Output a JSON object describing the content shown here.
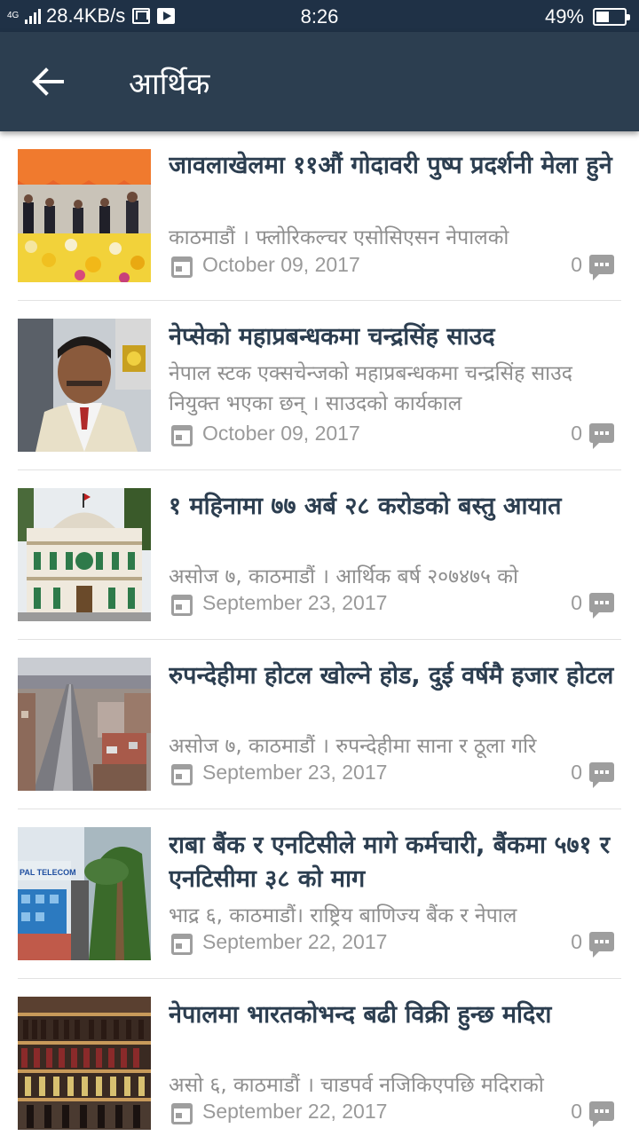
{
  "status_bar": {
    "network": "4G",
    "speed": "28.4KB/s",
    "time": "8:26",
    "battery": "49%"
  },
  "app_bar": {
    "back_icon": "arrow-left-icon",
    "title": "आर्थिक"
  },
  "colors": {
    "status_bar": "#1f3146",
    "app_bar": "#2c3e50",
    "headline": "#2c3e50",
    "meta_text": "#9a9a9a"
  },
  "articles": [
    {
      "headline": "जावलाखेलमा ११औं गोदावरी पुष्प प्रदर्शनी मेला हुने",
      "excerpt": "काठमाडौं । फ्लोरिकल्चर एसोसिएसन नेपालको",
      "date": "October 09, 2017",
      "comments": "0",
      "thumbnail": "flower-exhibition-photo"
    },
    {
      "headline": "नेप्सेको महाप्रबन्धकमा चन्द्रसिंह साउद",
      "excerpt": "नेपाल स्टक एक्सचेन्जको महाप्रबन्धकमा चन्द्रसिंह साउद नियुक्त भएका छन् । साउदको कार्यकाल",
      "date": "October 09, 2017",
      "comments": "0",
      "thumbnail": "portrait-photo"
    },
    {
      "headline": "१ महिनामा ७७ अर्ब २८ करोडको बस्तु आयात",
      "excerpt": "असोज ७, काठमाडौं । आर्थिक बर्ष २०७४७५ को",
      "date": "September 23, 2017",
      "comments": "0",
      "thumbnail": "palace-building-photo"
    },
    {
      "headline": "रुपन्देहीमा होटल खोल्ने होड, दुई वर्षमै हजार होटल",
      "excerpt": "असोज ७, काठमाडौं । रुपन्देहीमा साना र ठूला गरि",
      "date": "September 23, 2017",
      "comments": "0",
      "thumbnail": "city-road-photo"
    },
    {
      "headline": "राबा बैंक र एनटिसीले मागे कर्मचारी, बैंकमा ५७१ र एनटिसीमा ३८ को माग",
      "excerpt": "भाद्र ६, काठमाडौं। राष्ट्रिय बाणिज्य बैंक र नेपाल",
      "date": "September 22, 2017",
      "comments": "0",
      "thumbnail": "telecom-building-photo",
      "thumbnail_sign": "PAL TELECOM"
    },
    {
      "headline": "नेपालमा भारतकोभन्द बढी विक्री हुन्छ मदिरा",
      "excerpt": "असो ६, काठमाडौं । चाडपर्व नजिकिएपछि मदिराको",
      "date": "September 22, 2017",
      "comments": "0",
      "thumbnail": "liquor-shelves-photo"
    }
  ]
}
